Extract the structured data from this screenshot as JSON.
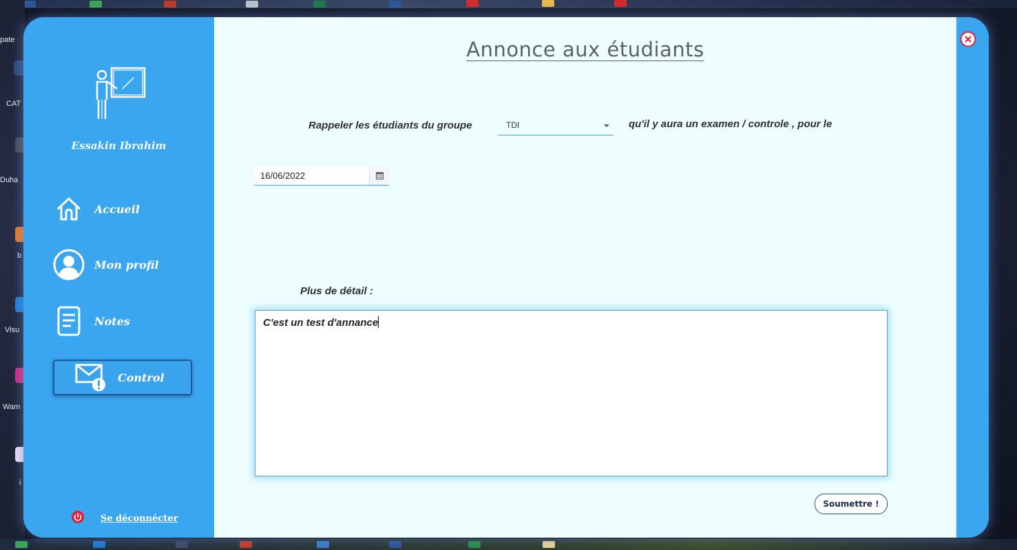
{
  "desktop": {
    "left_labels": [
      "pate",
      "CAT",
      "Duha",
      "b",
      "Visu",
      "Wam",
      "i"
    ]
  },
  "sidebar": {
    "user_name": "Essakin Ibrahim",
    "items": [
      {
        "label": "Accueil",
        "icon": "home-icon",
        "active": false
      },
      {
        "label": "Mon profil",
        "icon": "profile-icon",
        "active": false
      },
      {
        "label": "Notes",
        "icon": "notes-icon",
        "active": false
      },
      {
        "label": "Control",
        "icon": "mail-alert-icon",
        "active": true
      }
    ],
    "logout_label": "Se déconnécter"
  },
  "main": {
    "title": "Annonce aux étudiants",
    "sentence_part1": "Rappeler les étudiants du groupe",
    "group_value": "TDI",
    "sentence_part2": "qu'il y aura un examen / controle , pour le",
    "date_value": "16/06/2022",
    "detail_label": "Plus de détail :",
    "detail_text": "C'est un test d'annance",
    "submit_label": "Soumettre !"
  },
  "colors": {
    "sidebar": "#3ba6f0",
    "content": "#eefeff",
    "close": "#e0203a",
    "logout_icon": "#e0203a"
  }
}
